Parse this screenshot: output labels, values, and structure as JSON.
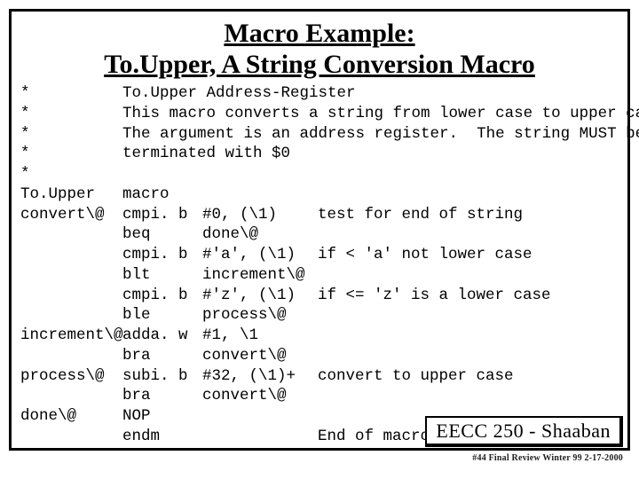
{
  "title_line1": "Macro Example:",
  "title_line2": "To.Upper, A String Conversion Macro",
  "comment_lines": [
    {
      "label": "*",
      "text": "To.Upper Address-Register"
    },
    {
      "label": "*",
      "text": "This macro converts a string from lower case to upper case."
    },
    {
      "label": "*",
      "text": "The argument is an address register.  The string MUST be"
    },
    {
      "label": "*",
      "text": "terminated with $0"
    },
    {
      "label": "*",
      "text": ""
    }
  ],
  "code_lines": [
    {
      "label": "To.Upper",
      "op": "macro",
      "arg": "",
      "note": ""
    },
    {
      "label": "convert\\@",
      "op": "cmpi. b",
      "arg": "#0, (\\1)",
      "note": "test for end of string"
    },
    {
      "label": "",
      "op": "beq",
      "arg": "done\\@",
      "note": ""
    },
    {
      "label": "",
      "op": "cmpi. b",
      "arg": "#'a', (\\1)",
      "note": "if < 'a' not lower case"
    },
    {
      "label": "",
      "op": "blt",
      "arg": "increment\\@",
      "note": ""
    },
    {
      "label": "",
      "op": "cmpi. b",
      "arg": "#'z', (\\1)",
      "note": "if <= 'z' is a lower case"
    },
    {
      "label": "",
      "op": "ble",
      "arg": "process\\@",
      "note": ""
    },
    {
      "label": "increment\\@",
      "op": "adda. w",
      "arg": "#1, \\1",
      "note": ""
    },
    {
      "label": "",
      "op": "bra",
      "arg": "convert\\@",
      "note": ""
    },
    {
      "label": "process\\@",
      "op": "subi. b",
      "arg": "#32, (\\1)+",
      "note": "convert to upper case"
    },
    {
      "label": "",
      "op": "bra",
      "arg": "convert\\@",
      "note": ""
    },
    {
      "label": "done\\@",
      "op": "NOP",
      "arg": "",
      "note": ""
    },
    {
      "label": "",
      "op": "endm",
      "arg": "",
      "note": "End of macro"
    }
  ],
  "footer_tag": "EECC 250 - Shaaban",
  "footer_small": "#44  Final Review  Winter 99  2-17-2000"
}
